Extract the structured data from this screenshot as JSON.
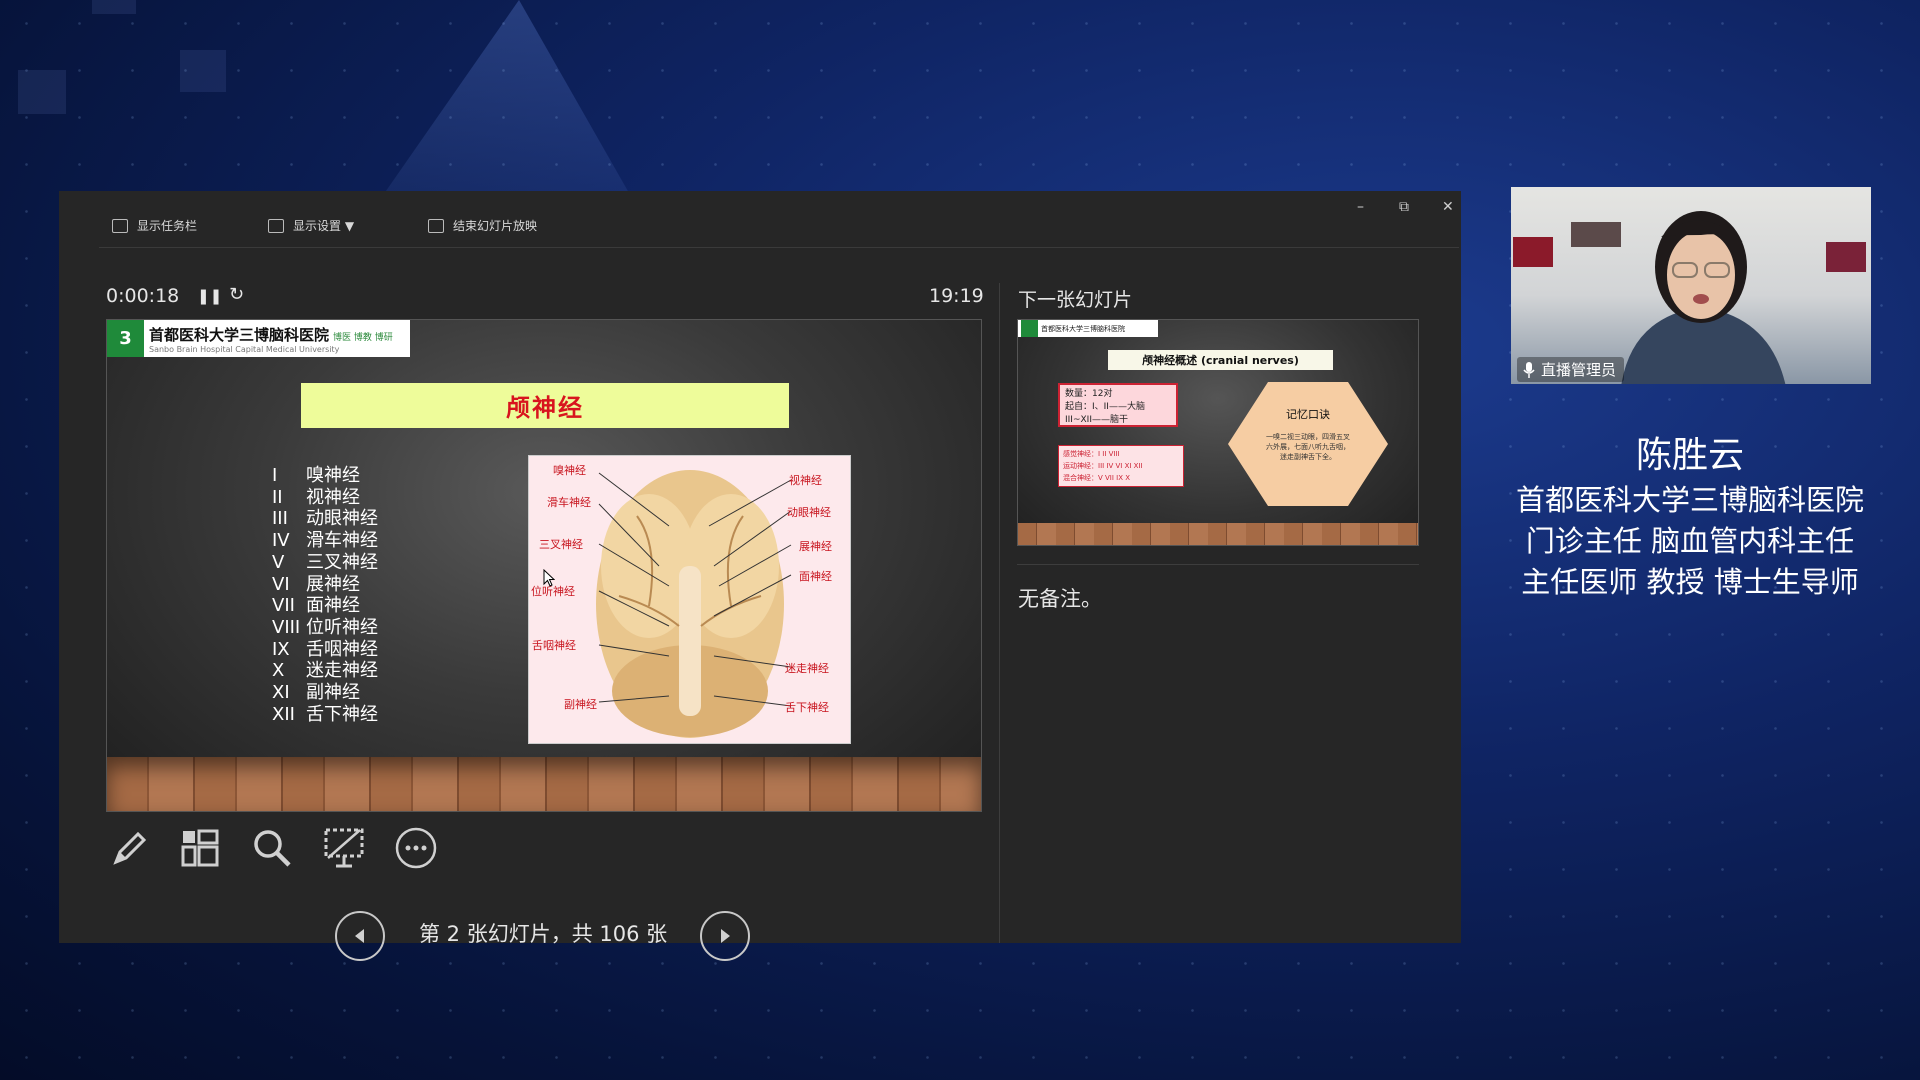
{
  "toolbar": {
    "show_taskbar": "显示任务栏",
    "display_settings": "显示设置 ▼",
    "end_show": "结束幻灯片放映"
  },
  "window_controls": {
    "minimize": "–",
    "restore": "⧉",
    "close": "✕"
  },
  "presenter": {
    "elapsed": "0:00:18",
    "clock": "19:19",
    "next_slide_label": "下一张幻灯片",
    "notes": "无备注。",
    "counter": "第 2 张幻灯片，共 106 张"
  },
  "current_slide": {
    "hospital_name": "首都医科大学三博脑科医院",
    "hospital_motto": "博医 博教 博研",
    "hospital_sub": "Sanbo Brain Hospital Capital Medical University",
    "logo_text": "3",
    "title": "颅神经",
    "nerves": [
      {
        "num": "I",
        "name": "嗅神经"
      },
      {
        "num": "II",
        "name": "视神经"
      },
      {
        "num": "III",
        "name": "动眼神经"
      },
      {
        "num": "IV",
        "name": "滑车神经"
      },
      {
        "num": "V",
        "name": "三叉神经"
      },
      {
        "num": "VI",
        "name": "展神经"
      },
      {
        "num": "VII",
        "name": "面神经"
      },
      {
        "num": "VIII",
        "name": "位听神经"
      },
      {
        "num": "IX",
        "name": "舌咽神经"
      },
      {
        "num": "X",
        "name": "迷走神经"
      },
      {
        "num": "XI",
        "name": "副神经"
      },
      {
        "num": "XII",
        "name": "舌下神经"
      }
    ],
    "diagram_labels": [
      "嗅神经",
      "滑车神经",
      "三叉神经",
      "位听神经",
      "舌咽神经",
      "副神经",
      "视神经",
      "动眼神经",
      "展神经",
      "面神经",
      "迷走神经",
      "舌下神经"
    ]
  },
  "next_slide": {
    "hospital_name": "首都医科大学三博脑科医院",
    "title": "颅神经概述 (cranial nerves)",
    "box_lines": [
      "数量：12对",
      "起自：I、II——大脑",
      "III~XII——脑干"
    ],
    "box2_lines": [
      "感觉神经：I II VIII",
      "运动神经：III IV VI XI XII",
      "混合神经：V VII IX X"
    ],
    "hex_title": "记忆口诀",
    "hex_text": "一嗅二视三动眼，四滑五叉六外展，七面八听九舌咽，迷走副神舌下全。"
  },
  "video": {
    "caption": "直播管理员"
  },
  "speaker": {
    "name": "陈胜云",
    "line1": "首都医科大学三博脑科医院",
    "line2": "门诊主任 脑血管内科主任",
    "line3": "主任医师 教授 博士生导师"
  },
  "colors": {
    "slide_title_bg": "#eefc9a",
    "slide_title_text": "#d8141e",
    "window_bg": "#262626",
    "background": "#0f2463"
  },
  "icons": [
    "taskbar-icon",
    "display-settings-icon",
    "end-show-icon",
    "pause-icon",
    "reset-icon",
    "pen-icon",
    "slides-grid-icon",
    "zoom-icon",
    "screen-icon",
    "more-icon",
    "prev-icon",
    "next-icon",
    "mic-icon"
  ]
}
